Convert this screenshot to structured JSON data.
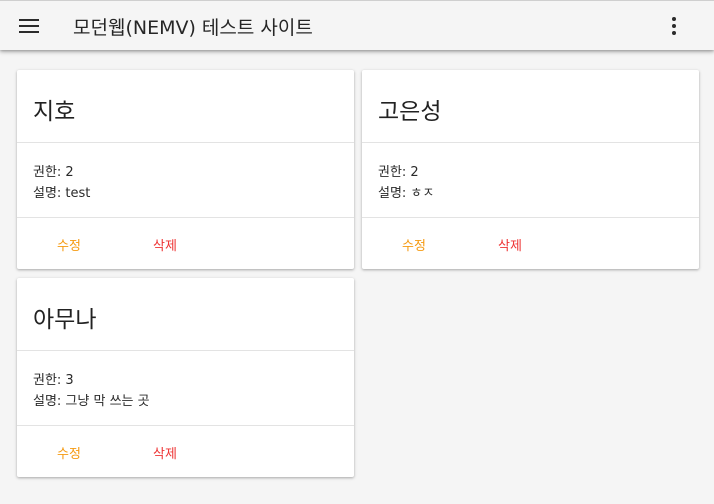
{
  "appbar": {
    "title": "모던웹(NEMV) 테스트 사이트",
    "menu_icon": "menu-icon",
    "more_icon": "more-vert-icon"
  },
  "cards": [
    {
      "name": "지호",
      "level_label": "권한: 2",
      "desc_label": "설명: test",
      "edit_label": "수정",
      "delete_label": "삭제"
    },
    {
      "name": "고은성",
      "level_label": "권한: 2",
      "desc_label": "설명: ㅎㅈ",
      "edit_label": "수정",
      "delete_label": "삭제"
    },
    {
      "name": "아무나",
      "level_label": "권한: 3",
      "desc_label": "설명: 그냥 막 쓰는 곳",
      "edit_label": "수정",
      "delete_label": "삭제"
    }
  ],
  "colors": {
    "edit": "#f59a12",
    "delete": "#ee3333",
    "background": "#f5f5f5"
  }
}
